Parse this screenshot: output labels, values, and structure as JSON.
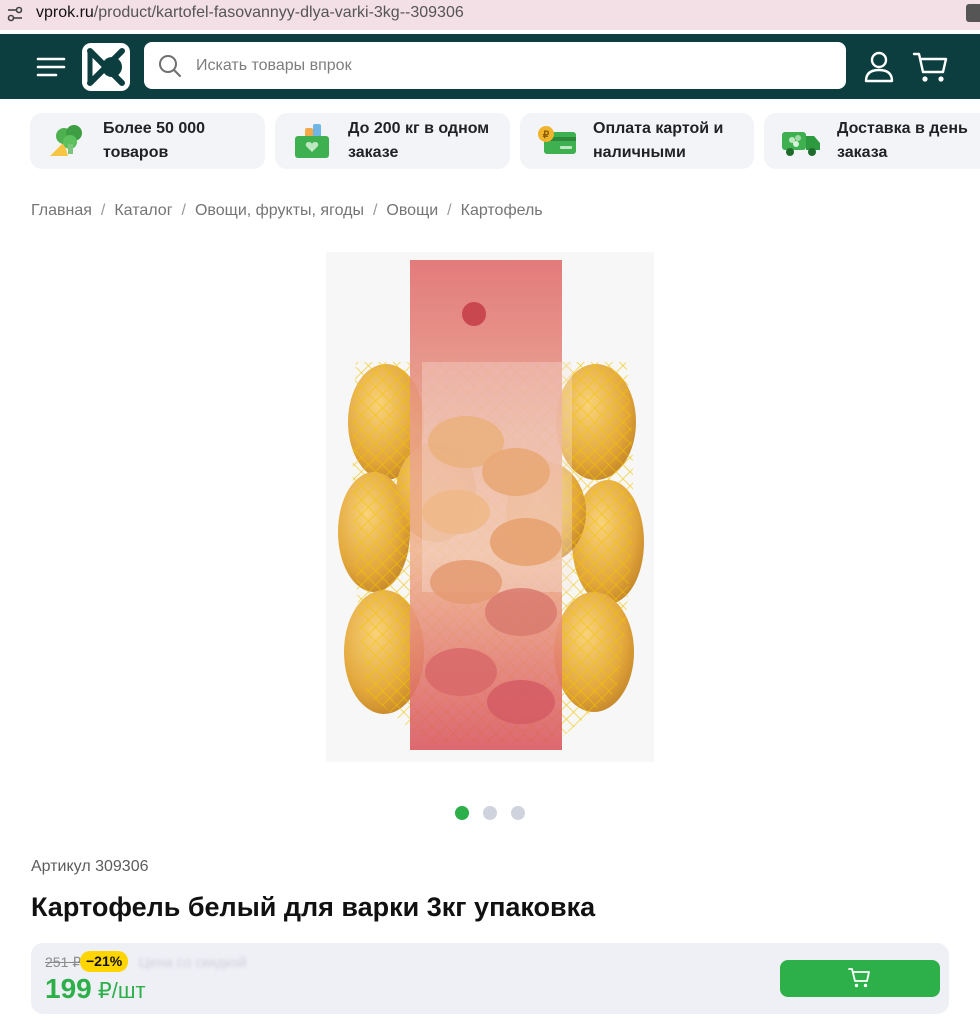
{
  "browser": {
    "url_host": "vprok.ru",
    "url_path": "/product/kartofel-fasovannyy-dlya-varki-3kg--309306"
  },
  "header": {
    "search_placeholder": "Искать товары впрок",
    "colors": {
      "background": "#0c3e3f",
      "accent": "#2db04a"
    },
    "icons": [
      "menu-icon",
      "logo",
      "search-icon",
      "user-icon",
      "cart-icon"
    ]
  },
  "features": [
    {
      "text": "Более 50 000\nтоваров",
      "icon": "broccoli-cheese-icon"
    },
    {
      "text": "До 200 кг в одном\nзаказе",
      "icon": "box-icon"
    },
    {
      "text": "Оплата картой и\nналичными",
      "icon": "card-coin-icon"
    },
    {
      "text": "Доставка в день\nзаказа",
      "icon": "truck-icon"
    }
  ],
  "breadcrumb": [
    "Главная",
    "Каталог",
    "Овощи, фрукты, ягоды",
    "Овощи",
    "Картофель"
  ],
  "gallery": {
    "count": 3,
    "active": 1
  },
  "product": {
    "article": "Артикул 309306",
    "title": "Картофель белый для варки 3кг упаковка"
  },
  "price": {
    "old": "251 ₽",
    "discount": "−21%",
    "note": "Цена со скидкой",
    "current": "199",
    "unit": "₽/шт"
  }
}
